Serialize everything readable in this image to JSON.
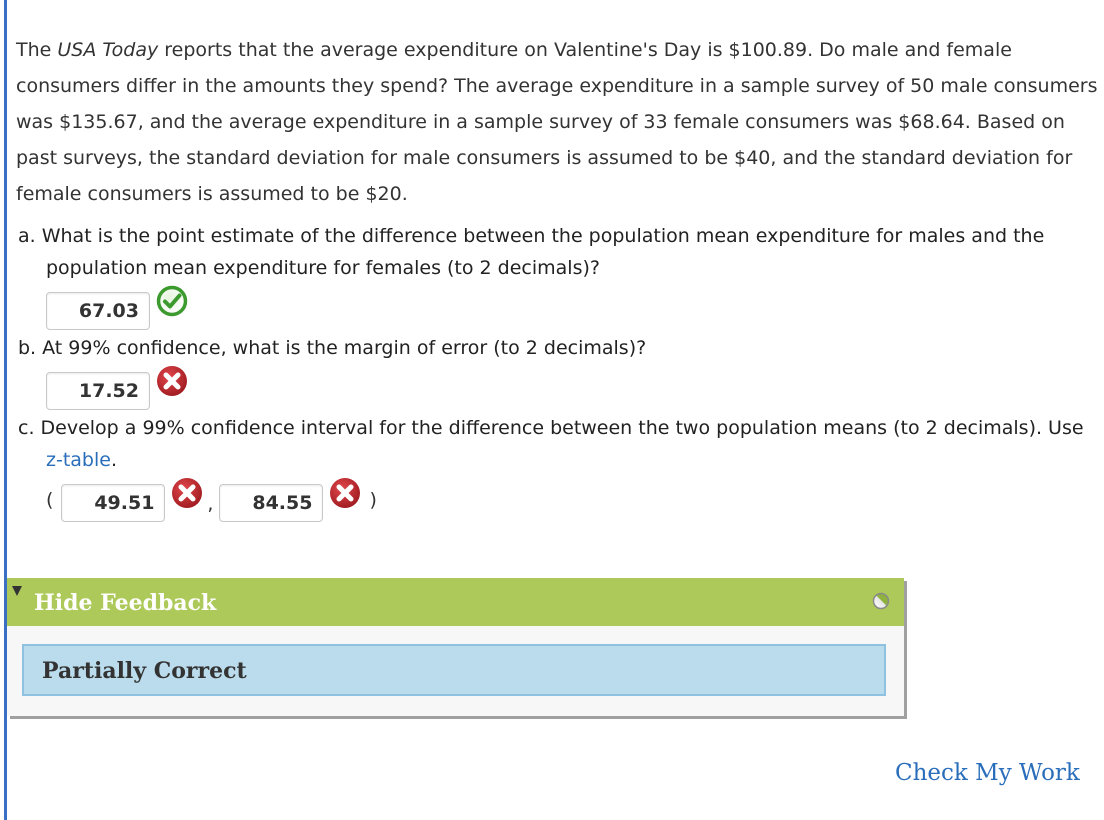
{
  "problem": {
    "intro_before": "The ",
    "publication": "USA Today",
    "intro_after": " reports that the average expenditure on Valentine's Day is $100.89. Do male and female consumers differ in the amounts they spend? The average expenditure in a sample survey of 50 male consumers was $135.67, and the average expenditure in a sample survey of 33 female consumers was $68.64. Based on past surveys, the standard deviation for male consumers is assumed to be $40, and the standard deviation for female consumers is assumed to be $20."
  },
  "questions": {
    "a": {
      "text": "a. What is the point estimate of the difference between the population mean expenditure for males and the population mean expenditure for females (to 2 decimals)?",
      "answer": "67.03",
      "status": "correct"
    },
    "b": {
      "text": "b. At 99% confidence, what is the margin of error (to 2 decimals)?",
      "answer": "17.52",
      "status": "incorrect"
    },
    "c": {
      "text_before": "c. Develop a 99% confidence interval for the difference between the two population means (to 2 decimals). Use ",
      "link_text": "z-table",
      "text_after": ".",
      "open_paren": "(",
      "comma": ",",
      "close_paren": ")",
      "lower": "49.51",
      "lower_status": "incorrect",
      "upper": "84.55",
      "upper_status": "incorrect"
    }
  },
  "feedback": {
    "toggle_label": "Hide Feedback",
    "status_text": "Partially Correct"
  },
  "actions": {
    "check_my_work": "Check My Work"
  },
  "colors": {
    "feedback_header": "#adc95a",
    "feedback_status_bg": "#bbdcec",
    "link": "#2a6ebb",
    "correct": "#3c9a2e",
    "incorrect": "#c0262c"
  }
}
